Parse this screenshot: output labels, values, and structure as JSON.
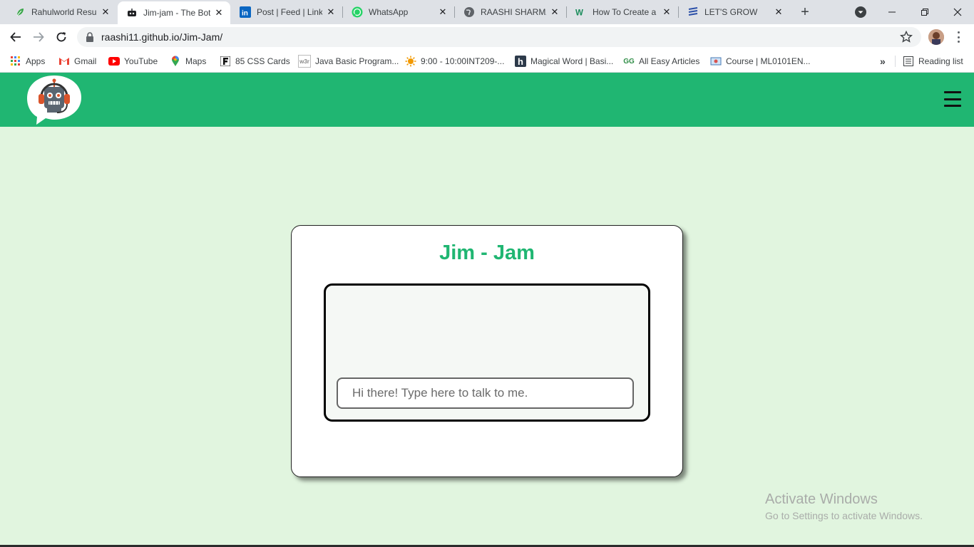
{
  "browser": {
    "tabs": [
      {
        "title": "Rahulworld Resume",
        "icon": "leaf-icon"
      },
      {
        "title": "Jim-jam - The Bot",
        "icon": "robot-icon",
        "active": true
      },
      {
        "title": "Post | Feed | LinkedIn",
        "icon": "linkedin-icon"
      },
      {
        "title": "WhatsApp",
        "icon": "whatsapp-icon"
      },
      {
        "title": "RAASHI SHARMA",
        "icon": "globe-icon"
      },
      {
        "title": "How To Create a",
        "icon": "w-icon"
      },
      {
        "title": "LET'S GROW",
        "icon": "stack-icon"
      }
    ],
    "url": "raashi11.github.io/Jim-Jam/",
    "bookmarks": [
      {
        "label": "Apps",
        "icon": "apps-grid-icon"
      },
      {
        "label": "Gmail",
        "icon": "gmail-icon"
      },
      {
        "label": "YouTube",
        "icon": "youtube-icon"
      },
      {
        "label": "Maps",
        "icon": "maps-pin-icon"
      },
      {
        "label": "85 CSS Cards",
        "icon": "f-icon"
      },
      {
        "label": "Java Basic Program...",
        "icon": "w3r-icon"
      },
      {
        "label": "9:00 - 10:00INT209-...",
        "icon": "sun-icon"
      },
      {
        "label": "Magical Word | Basi...",
        "icon": "h-icon"
      },
      {
        "label": "All Easy Articles",
        "icon": "gfg-icon"
      },
      {
        "label": "Course | ML0101EN...",
        "icon": "course-icon"
      }
    ],
    "more_bookmarks": "»",
    "reading_list": "Reading list"
  },
  "page": {
    "title": "Jim - Jam",
    "input_placeholder": "Hi there! Type here to talk to me.",
    "brand_color": "#20b672",
    "background_color": "#e1f5df"
  },
  "watermark": {
    "line1": "Activate Windows",
    "line2": "Go to Settings to activate Windows."
  }
}
